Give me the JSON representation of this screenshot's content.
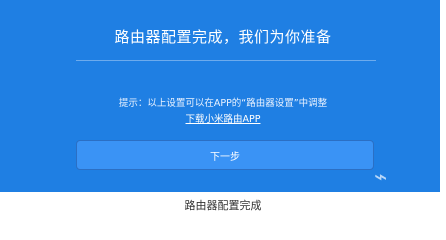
{
  "dialog": {
    "title": "路由器配置完成，我们为你准备",
    "tip": "提示：以上设置可以在APP的“路由器设置”中调整",
    "download_link": "下载小米路由APP",
    "next_button": "下一步"
  },
  "caption": "路由器配置完成",
  "colors": {
    "panel_bg": "#1f7fe3",
    "button_bg": "#3a93f5",
    "text_light": "#ffffff"
  }
}
